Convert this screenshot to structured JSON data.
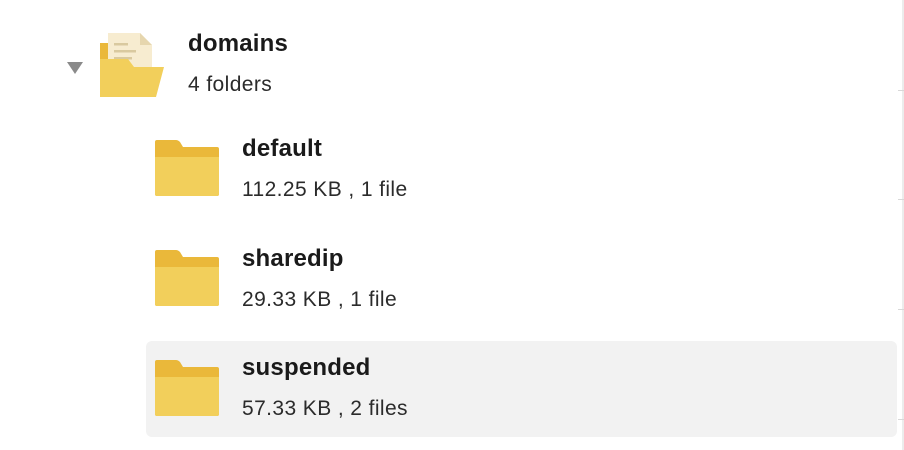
{
  "tree": {
    "root": {
      "name": "domains",
      "meta": "4 folders",
      "expanded": true,
      "icon": "open-folder-with-documents-icon"
    },
    "children": [
      {
        "name": "default",
        "meta": "112.25 KB ,  1 file",
        "icon": "folder-icon",
        "selected": false
      },
      {
        "name": "sharedip",
        "meta": "29.33 KB ,  1 file",
        "icon": "folder-icon",
        "selected": false
      },
      {
        "name": "suspended",
        "meta": "57.33 KB , 2 files",
        "icon": "folder-icon",
        "selected": true
      }
    ]
  },
  "colors": {
    "folder_front": "#f2cf5b",
    "folder_back": "#eab83a",
    "paper": "#f7ecd0",
    "selected_row": "#f2f2f2",
    "toggle": "#8a8a8a"
  }
}
